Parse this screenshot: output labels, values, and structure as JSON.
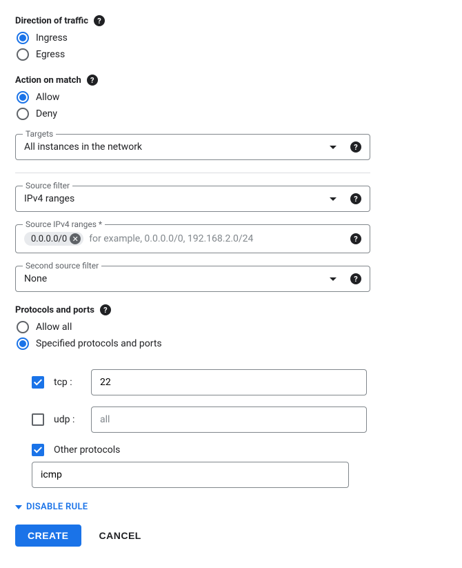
{
  "direction": {
    "header": "Direction of traffic",
    "options": [
      "Ingress",
      "Egress"
    ],
    "selected": "Ingress"
  },
  "action": {
    "header": "Action on match",
    "options": [
      "Allow",
      "Deny"
    ],
    "selected": "Allow"
  },
  "targets": {
    "label": "Targets",
    "value": "All instances in the network"
  },
  "source_filter": {
    "label": "Source filter",
    "value": "IPv4 ranges"
  },
  "source_ipv4": {
    "label": "Source IPv4 ranges *",
    "chip": "0.0.0.0/0",
    "placeholder": "for example, 0.0.0.0/0, 192.168.2.0/24"
  },
  "second_source_filter": {
    "label": "Second source filter",
    "value": "None"
  },
  "protocols": {
    "header": "Protocols and ports",
    "options": [
      "Allow all",
      "Specified protocols and ports"
    ],
    "selected": "Specified protocols and ports",
    "tcp": {
      "label": "tcp :",
      "checked": true,
      "value": "22"
    },
    "udp": {
      "label": "udp :",
      "checked": false,
      "placeholder": "all"
    },
    "other": {
      "label": "Other protocols",
      "checked": true,
      "value": "icmp"
    }
  },
  "disable_rule": "DISABLE RULE",
  "buttons": {
    "create": "CREATE",
    "cancel": "CANCEL"
  }
}
